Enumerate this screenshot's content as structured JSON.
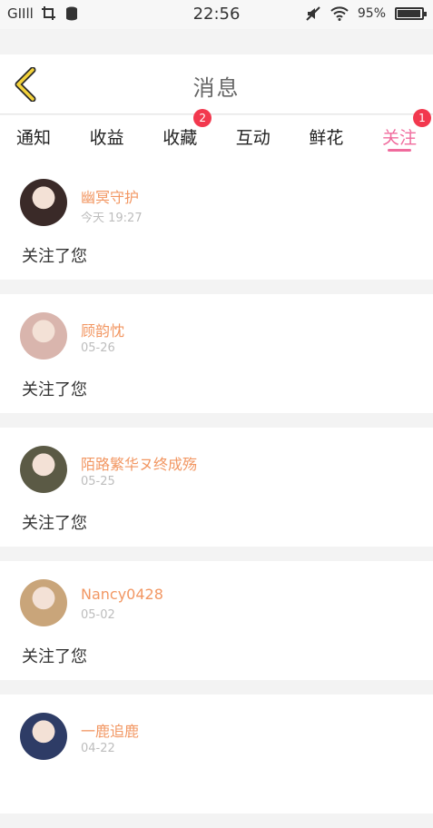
{
  "status_bar": {
    "signal": "GIIll",
    "time": "22:56",
    "battery_percent": "95%",
    "battery_level": 0.95
  },
  "header": {
    "title": "消息"
  },
  "tabs": [
    {
      "label": "通知",
      "badge": null,
      "active": false
    },
    {
      "label": "收益",
      "badge": null,
      "active": false
    },
    {
      "label": "收藏",
      "badge": "2",
      "active": false
    },
    {
      "label": "互动",
      "badge": null,
      "active": false
    },
    {
      "label": "鲜花",
      "badge": null,
      "active": false
    },
    {
      "label": "关注",
      "badge": "1",
      "active": true
    }
  ],
  "notifications": [
    {
      "name": "幽冥守护",
      "date": "今天 19:27",
      "message": "关注了您",
      "avatar_color": "#3a2a28"
    },
    {
      "name": "顾韵忱",
      "date": "05-26",
      "message": "关注了您",
      "avatar_color": "#d9b5ad"
    },
    {
      "name": "陌路繁华ヌ终成殇",
      "date": "05-25",
      "message": "关注了您",
      "avatar_color": "#5b5a45"
    },
    {
      "name": "Nancy0428",
      "date": "05-02",
      "message": "关注了您",
      "avatar_color": "#c9a57a"
    },
    {
      "name": "一鹿追鹿",
      "date": "04-22",
      "message": "",
      "avatar_color": "#2e3c66"
    }
  ],
  "colors": {
    "accent": "#f06b9d",
    "name": "#f29763",
    "badge": "#f2384e"
  }
}
